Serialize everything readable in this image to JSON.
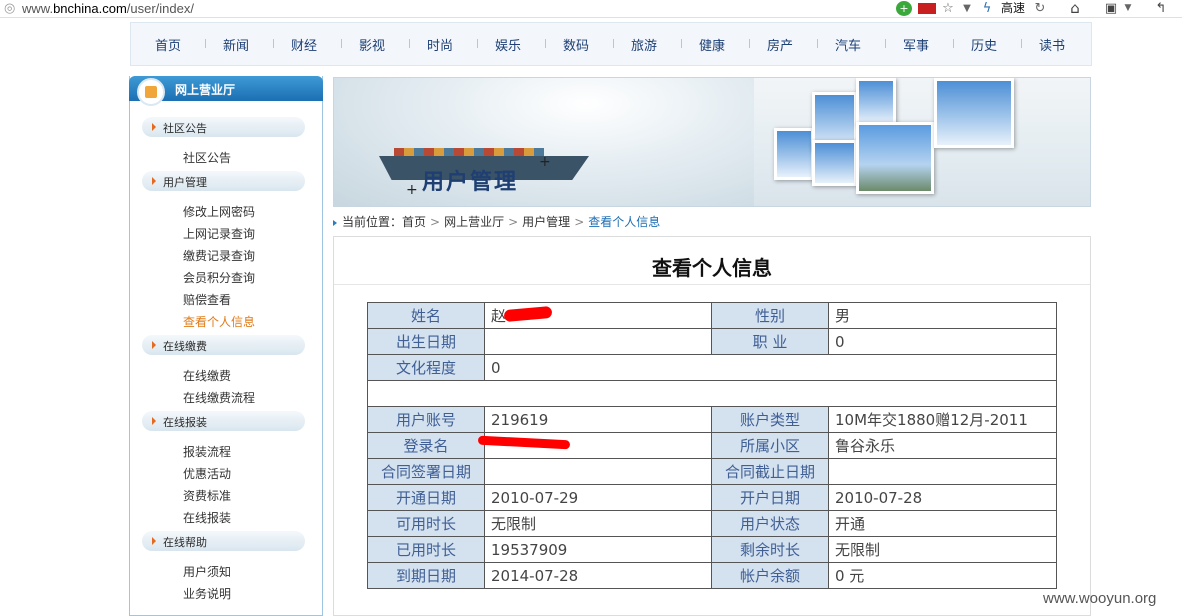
{
  "browser": {
    "url_prefix": "www.",
    "url_domain": "bnchina.com",
    "url_path": "/user/index/",
    "speed_label": "高速"
  },
  "nav": {
    "items": [
      "首页",
      "新闻",
      "财经",
      "影视",
      "时尚",
      "娱乐",
      "数码",
      "旅游",
      "健康",
      "房产",
      "汽车",
      "军事",
      "历史",
      "读书"
    ]
  },
  "sidebar": {
    "title": "网上营业厅",
    "sections": [
      {
        "label": "社区公告",
        "items": [
          "社区公告"
        ]
      },
      {
        "label": "用户管理",
        "items": [
          "修改上网密码",
          "上网记录查询",
          "缴费记录查询",
          "会员积分查询",
          "赔偿查看",
          "查看个人信息"
        ]
      },
      {
        "label": "在线缴费",
        "items": [
          "在线缴费",
          "在线缴费流程"
        ]
      },
      {
        "label": "在线报装",
        "items": [
          "报装流程",
          "优惠活动",
          "资费标准",
          "在线报装"
        ]
      },
      {
        "label": "在线帮助",
        "items": [
          "用户须知",
          "业务说明"
        ]
      }
    ],
    "active_item": "查看个人信息"
  },
  "banner": {
    "title": "用户管理"
  },
  "breadcrumb": {
    "prefix": "当前位置：",
    "items": [
      "首页",
      "网上营业厅",
      "用户管理"
    ],
    "current": "查看个人信息"
  },
  "page": {
    "title": "查看个人信息"
  },
  "info": {
    "name_label": "姓名",
    "name_value": "赵",
    "gender_label": "性别",
    "gender_value": "男",
    "birth_label": "出生日期",
    "birth_value": "",
    "job_label": "职 业",
    "job_value": "0",
    "edu_label": "文化程度",
    "edu_value": "0",
    "account_label": "用户账号",
    "account_value": "219619",
    "acct_type_label": "账户类型",
    "acct_type_value": "10M年交1880赠12月-2011",
    "login_label": "登录名",
    "login_value": "",
    "district_label": "所属小区",
    "district_value": "鲁谷永乐",
    "contract_sign_label": "合同签署日期",
    "contract_sign_value": "",
    "contract_end_label": "合同截止日期",
    "contract_end_value": "",
    "open_label": "开通日期",
    "open_value": "2010-07-29",
    "acct_open_label": "开户日期",
    "acct_open_value": "2010-07-28",
    "avail_label": "可用时长",
    "avail_value": "无限制",
    "status_label": "用户状态",
    "status_value": "开通",
    "used_label": "已用时长",
    "used_value": "19537909",
    "remain_label": "剩余时长",
    "remain_value": "无限制",
    "expire_label": "到期日期",
    "expire_value": "2014-07-28",
    "balance_label": "帐户余额",
    "balance_value": "0  元"
  },
  "watermark": "www.wooyun.org",
  "colors": {
    "nav_text": "#1d3f75",
    "label_bg": "#d4e1ee",
    "label_text": "#3f5f95",
    "active": "#e07b18",
    "redaction": "#ff0000"
  }
}
